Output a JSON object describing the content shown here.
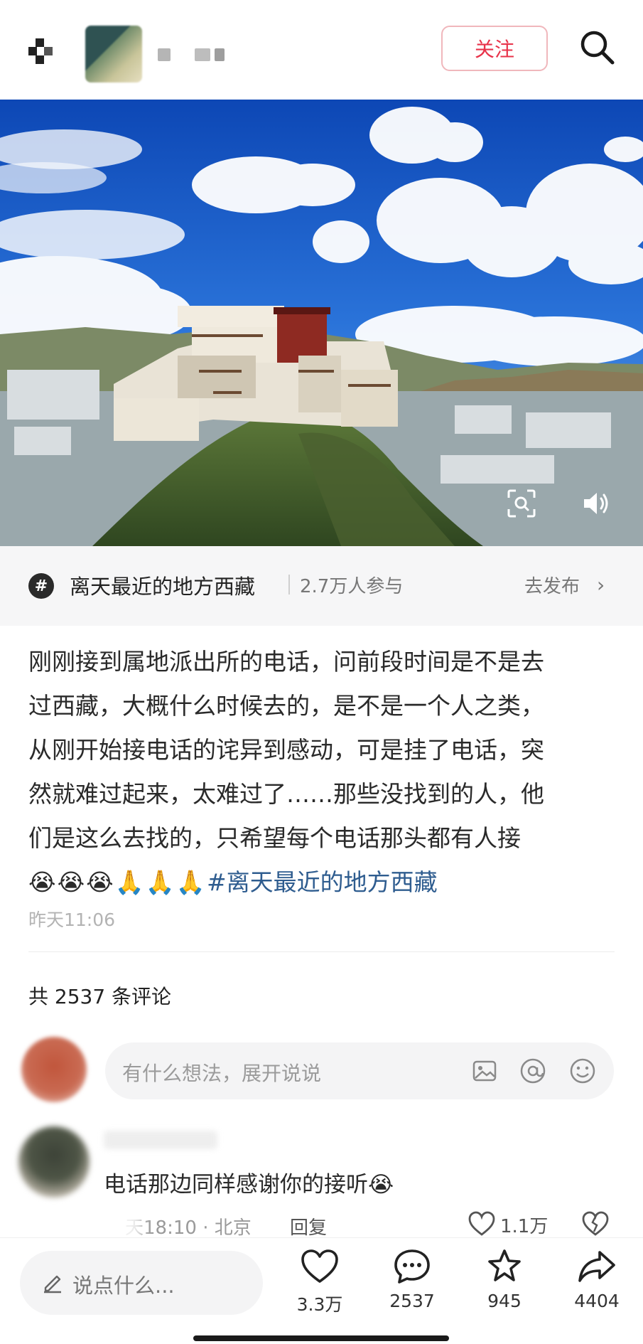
{
  "header": {
    "follow_label": "关注"
  },
  "topic": {
    "title": "离天最近的地方西藏",
    "participants": "2.7万人参与",
    "publish_label": "去发布"
  },
  "post": {
    "lines": [
      "刚刚接到属地派出所的电话，问前段时间是不是去",
      "过西藏，大概什么时候去的，是不是一个人之类，",
      "从刚开始接电话的诧异到感动，可是挂了电话，突",
      "然就难过起来，太难过了……那些没找到的人，他",
      "们是这么去找的，只希望每个电话那头都有人接"
    ],
    "emojis": [
      "😭",
      "😭",
      "😭",
      "🙏",
      "🙏",
      "🙏"
    ],
    "hashtag": "#离天最近的地方西藏",
    "time": "昨天11:06"
  },
  "comments": {
    "count_label": "共 2537 条评论",
    "input_placeholder": "有什么想法，展开说说",
    "items": [
      {
        "text": "电话那边同样感谢你的接听😭",
        "meta": "天18:10 · 北京",
        "reply_label": "回复",
        "likes": "1.1万"
      }
    ]
  },
  "bottom_bar": {
    "input_placeholder": "说点什么...",
    "likes": "3.3万",
    "comments": "2537",
    "favorites": "945",
    "shares": "4404"
  },
  "icons": {
    "search": "search-icon",
    "scan": "image-search-icon",
    "sound": "speaker-icon",
    "hash": "hash-icon",
    "chevron": "chevron-right-icon",
    "image": "image-icon",
    "mention": "at-icon",
    "emoji": "smiley-icon",
    "heart": "heart-icon",
    "comment": "comment-icon",
    "star": "star-icon",
    "share": "share-icon",
    "pencil": "pencil-icon"
  },
  "colors": {
    "accent": "#e8334a",
    "hashtag": "#2e5c8f",
    "muted": "#9a9a9a"
  }
}
